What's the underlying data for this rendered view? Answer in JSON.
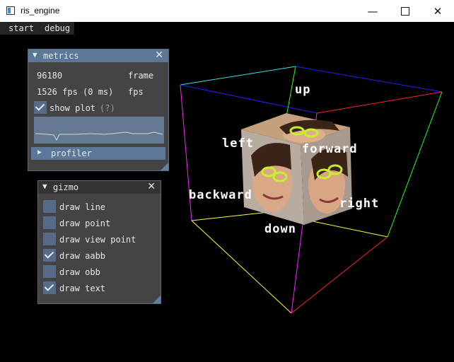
{
  "window": {
    "title": "ris_engine",
    "minimize_icon": "minimize-icon",
    "maximize_icon": "maximize-icon",
    "close_icon": "close-icon"
  },
  "menubar": {
    "items": [
      "start",
      "debug"
    ]
  },
  "metrics": {
    "title": "metrics",
    "frame_count": "96180",
    "frame_label": "frame",
    "fps_value": "1526 fps (0 ms)",
    "fps_label": "fps",
    "show_plot_label": "show plot",
    "show_plot_help": "(?)",
    "show_plot_checked": true,
    "profiler_label": "profiler"
  },
  "gizmo": {
    "title": "gizmo",
    "options": [
      {
        "label": "draw line",
        "checked": false
      },
      {
        "label": "draw point",
        "checked": false
      },
      {
        "label": "draw view point",
        "checked": false
      },
      {
        "label": "draw aabb",
        "checked": true
      },
      {
        "label": "draw obb",
        "checked": false
      },
      {
        "label": "draw text",
        "checked": true
      }
    ]
  },
  "scene": {
    "labels": {
      "up": "up",
      "left": "left",
      "forward": "forward",
      "backward": "backward",
      "right": "right",
      "down": "down"
    }
  },
  "colors": {
    "panel_bg": "#444444",
    "accent": "#5b7898",
    "titlebar": "#ffffff",
    "background": "#000000"
  }
}
